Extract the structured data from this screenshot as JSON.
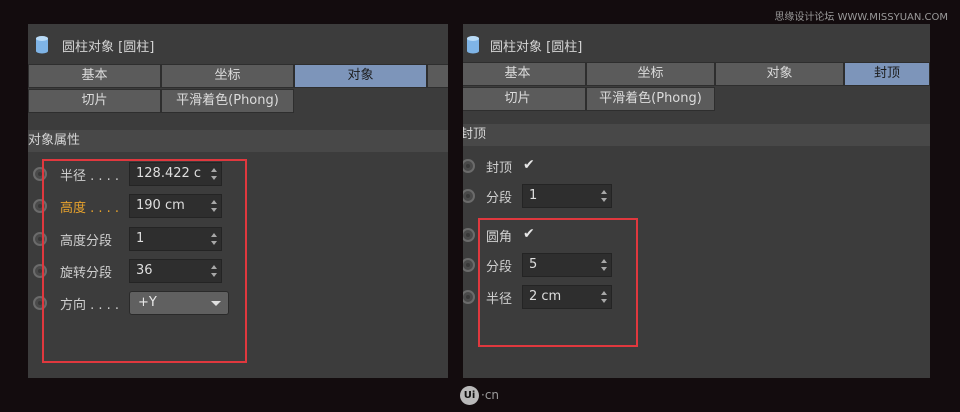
{
  "watermark": "思缘设计论坛 WWW.MISSYUAN.COM",
  "left_panel": {
    "title": "圆柱对象 [圆柱]",
    "tabs": [
      "基本",
      "坐标",
      "对象",
      ""
    ],
    "tabs_row2": [
      "切片",
      "平滑着色(Phong)"
    ],
    "active_tab": "对象",
    "section": "对象属性",
    "params": [
      {
        "label": "半径 . . . .",
        "value": "128.422 c"
      },
      {
        "label": "高度 . . . .",
        "value": "190 cm",
        "highlighted": true
      },
      {
        "label": "高度分段",
        "value": "1"
      },
      {
        "label": "旋转分段",
        "value": "36"
      },
      {
        "label": "方向 . . . .",
        "value": "+Y",
        "type": "dropdown"
      }
    ]
  },
  "right_panel": {
    "title": "圆柱对象 [圆柱]",
    "tabs": [
      "基本",
      "坐标",
      "对象",
      "封顶"
    ],
    "tabs_row2": [
      "切片",
      "平滑着色(Phong)"
    ],
    "active_tab": "封顶",
    "section": "封顶",
    "params": [
      {
        "label": "封顶",
        "checked": true,
        "check_mark": "✔"
      },
      {
        "label": "分段",
        "value": "1"
      },
      {
        "label": "圆角",
        "checked": true,
        "check_mark": "✔"
      },
      {
        "label": "分段",
        "value": "5"
      },
      {
        "label": "半径",
        "value": "2 cm"
      }
    ]
  },
  "logo": {
    "mark": "Ui",
    "suffix": "·cn"
  },
  "colors": {
    "background": "#130c0e",
    "panel": "#3c3c3c",
    "tab": "#5b5b5b",
    "tab_active": "#7d95ba",
    "field": "#2e2e2e",
    "highlight_label": "#e7a22c",
    "annotation_box": "#e0383e"
  },
  "icons": [
    "cylinder-icon",
    "radio-icon",
    "stepper-icon",
    "chevron-down-icon",
    "checkmark-icon"
  ]
}
